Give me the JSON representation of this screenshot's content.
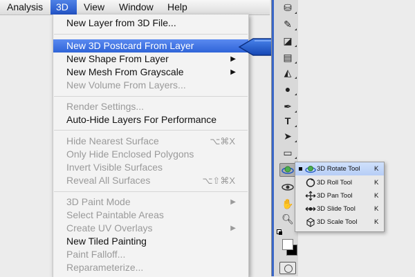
{
  "menubar": {
    "items": [
      {
        "label": "Analysis"
      },
      {
        "label": "3D"
      },
      {
        "label": "View"
      },
      {
        "label": "Window"
      },
      {
        "label": "Help"
      }
    ]
  },
  "menu_3d": {
    "items": [
      {
        "label": "New Layer from 3D File..."
      },
      {
        "label": "New 3D Postcard From Layer"
      },
      {
        "label": "New Shape From Layer",
        "submenu_arrow": "▶"
      },
      {
        "label": "New Mesh From Grayscale",
        "submenu_arrow": "▶"
      },
      {
        "label": "New Volume From Layers..."
      },
      {
        "label": "Render Settings..."
      },
      {
        "label": "Auto-Hide Layers For Performance"
      },
      {
        "label": "Hide Nearest Surface",
        "shortcut": "⌥⌘X"
      },
      {
        "label": "Only Hide Enclosed Polygons"
      },
      {
        "label": "Invert Visible Surfaces"
      },
      {
        "label": "Reveal All Surfaces",
        "shortcut": "⌥⇧⌘X"
      },
      {
        "label": "3D Paint Mode",
        "submenu_arrow": "▶"
      },
      {
        "label": "Select Paintable Areas"
      },
      {
        "label": "Create UV Overlays",
        "submenu_arrow": "▶"
      },
      {
        "label": "New Tiled Painting"
      },
      {
        "label": "Paint Falloff..."
      },
      {
        "label": "Reparameterize..."
      }
    ]
  },
  "tool_flyout": {
    "items": [
      {
        "label": "3D Rotate Tool",
        "key": "K",
        "selected": true
      },
      {
        "label": "3D Roll Tool",
        "key": "K"
      },
      {
        "label": "3D Pan Tool",
        "key": "K"
      },
      {
        "label": "3D Slide Tool",
        "key": "K"
      },
      {
        "label": "3D Scale Tool",
        "key": "K"
      }
    ]
  },
  "toolbar": {
    "tools": [
      {
        "icon": "clone-stamp-icon"
      },
      {
        "icon": "history-brush-icon"
      },
      {
        "icon": "eraser-icon"
      },
      {
        "icon": "gradient-icon"
      },
      {
        "icon": "blur-icon"
      },
      {
        "icon": "dodge-icon"
      },
      {
        "icon": "pen-icon"
      },
      {
        "icon": "type-icon"
      },
      {
        "icon": "path-selection-icon"
      },
      {
        "icon": "shape-icon"
      },
      {
        "icon": "3d-rotate-icon"
      },
      {
        "icon": "3d-orbit-icon"
      },
      {
        "icon": "hand-icon"
      },
      {
        "icon": "zoom-icon"
      }
    ],
    "type_glyph": "T"
  },
  "colors": {
    "menu_highlight": "#2f64d8",
    "callout": "#1f57c4",
    "disabled_text": "#9a9a9a"
  }
}
